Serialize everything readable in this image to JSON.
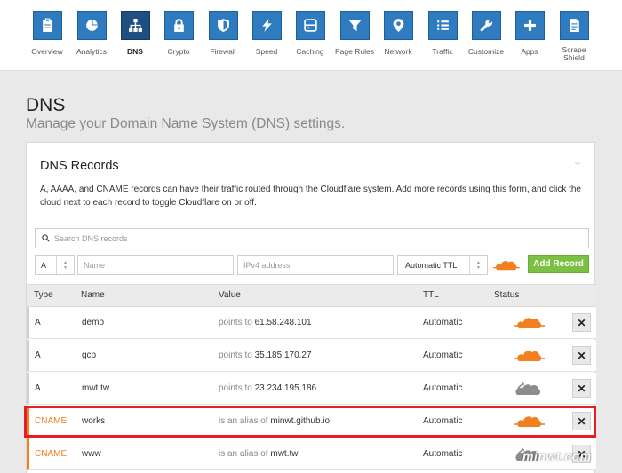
{
  "nav": {
    "items": [
      {
        "label": "Overview",
        "icon": "clipboard-icon"
      },
      {
        "label": "Analytics",
        "icon": "pie-chart-icon"
      },
      {
        "label": "DNS",
        "icon": "network-icon",
        "active": true
      },
      {
        "label": "Crypto",
        "icon": "lock-icon"
      },
      {
        "label": "Firewall",
        "icon": "shield-icon"
      },
      {
        "label": "Speed",
        "icon": "lightning-icon"
      },
      {
        "label": "Caching",
        "icon": "server-icon"
      },
      {
        "label": "Page Rules",
        "icon": "filter-icon"
      },
      {
        "label": "Network",
        "icon": "map-pin-icon"
      },
      {
        "label": "Traffic",
        "icon": "list-icon"
      },
      {
        "label": "Customize",
        "icon": "wrench-icon"
      },
      {
        "label": "Apps",
        "icon": "plus-icon"
      },
      {
        "label": "Scrape\nShield",
        "icon": "document-icon"
      }
    ]
  },
  "page": {
    "title": "DNS",
    "subtitle": "Manage your Domain Name System (DNS) settings."
  },
  "card": {
    "title": "DNS Records",
    "description": "A, AAAA, and CNAME records can have their traffic routed through the Cloudflare system. Add more records using this form, and click the cloud next to each record to toggle Cloudflare on or off."
  },
  "search": {
    "placeholder": "Search DNS records"
  },
  "add_form": {
    "type_value": "A",
    "name_placeholder": "Name",
    "value_placeholder": "IPv4 address",
    "ttl_value": "Automatic TTL",
    "add_label": "Add Record"
  },
  "table": {
    "headers": {
      "type": "Type",
      "name": "Name",
      "value": "Value",
      "ttl": "TTL",
      "status": "Status"
    },
    "rows": [
      {
        "type": "A",
        "name": "demo",
        "prefix": "points to",
        "target": "61.58.248.101",
        "ttl": "Automatic",
        "proxied": true
      },
      {
        "type": "A",
        "name": "gcp",
        "prefix": "points to",
        "target": "35.185.170.27",
        "ttl": "Automatic",
        "proxied": true
      },
      {
        "type": "A",
        "name": "mwt.tw",
        "prefix": "points to",
        "target": "23.234.195.186",
        "ttl": "Automatic",
        "proxied": false
      },
      {
        "type": "CNAME",
        "name": "works",
        "prefix": "is an alias of",
        "target": "minwt.github.io",
        "ttl": "Automatic",
        "proxied": true
      },
      {
        "type": "CNAME",
        "name": "www",
        "prefix": "is an alias of",
        "target": "mwt.tw",
        "ttl": "Automatic",
        "proxied": false
      }
    ],
    "delete_label": "✕"
  },
  "watermark": "minwt.com",
  "colors": {
    "nav_tile": "#2f7bbf",
    "nav_tile_active": "#1f4f82",
    "cloud_on": "#f38020",
    "cloud_off": "#8c8c8c",
    "add_button": "#7bc043",
    "highlight": "#e41e25"
  }
}
